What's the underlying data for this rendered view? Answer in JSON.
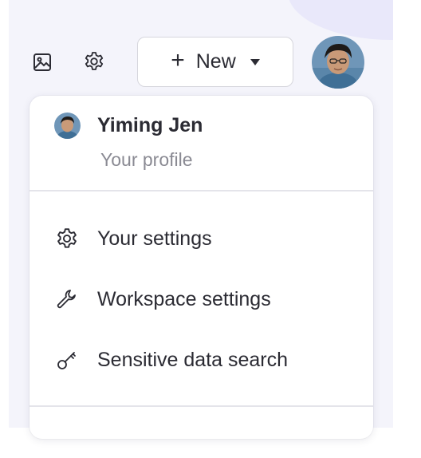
{
  "toolbar": {
    "image_icon": "image-icon",
    "settings_icon": "gear-icon",
    "new_button": {
      "plus": "+",
      "label": "New"
    },
    "avatar_icon": "user-avatar"
  },
  "menu": {
    "profile": {
      "name": "Yiming Jen",
      "subtitle": "Your profile"
    },
    "items": [
      {
        "label": "Your settings",
        "icon": "gear-icon"
      },
      {
        "label": "Workspace settings",
        "icon": "wrench-icon"
      },
      {
        "label": "Sensitive data search",
        "icon": "key-icon"
      }
    ]
  },
  "colors": {
    "background": "#f4f4fb",
    "text": "#2b2b33",
    "muted_text": "#8a8a93",
    "divider": "#e4e4ea"
  }
}
